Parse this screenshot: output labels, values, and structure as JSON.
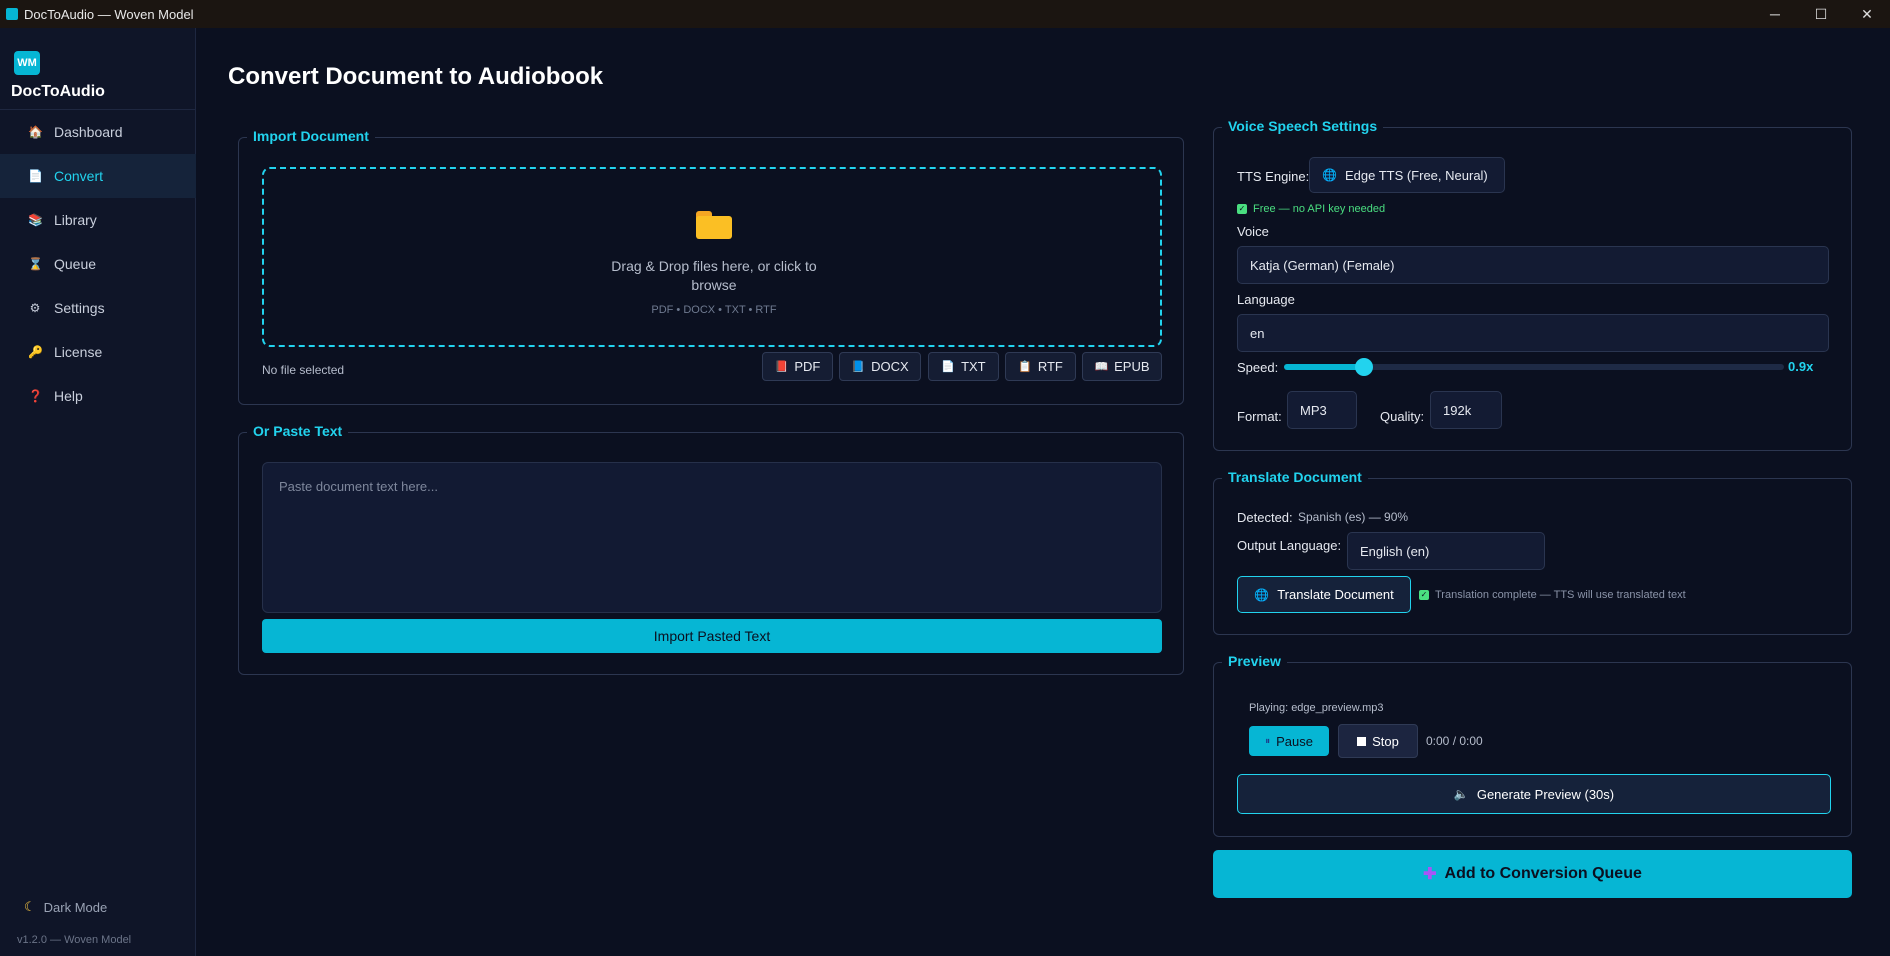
{
  "window": {
    "title": "DocToAudio — Woven Model",
    "controls": {
      "minimize": "─",
      "maximize": "☐",
      "close": "✕"
    }
  },
  "sidebar": {
    "logo_text": "WM",
    "brand": "DocToAudio",
    "items": [
      {
        "label": "Dashboard",
        "icon": "home-icon",
        "glyph": "🏠",
        "active": false
      },
      {
        "label": "Convert",
        "icon": "document-icon",
        "glyph": "📄",
        "active": true
      },
      {
        "label": "Library",
        "icon": "books-icon",
        "glyph": "📚",
        "active": false
      },
      {
        "label": "Queue",
        "icon": "hourglass-icon",
        "glyph": "⌛",
        "active": false
      },
      {
        "label": "Settings",
        "icon": "gear-icon",
        "glyph": "⚙",
        "active": false
      },
      {
        "label": "License",
        "icon": "key-icon",
        "glyph": "🔑",
        "active": false
      },
      {
        "label": "Help",
        "icon": "question-icon",
        "glyph": "❓",
        "active": false
      }
    ],
    "dark_mode_label": "Dark Mode",
    "version": "v1.2.0 — Woven Model"
  },
  "page": {
    "title": "Convert Document to Audiobook"
  },
  "import_document": {
    "title": "Import Document",
    "drop_text": "Drag & Drop files here, or click to browse",
    "formats_hint": "PDF • DOCX • TXT • RTF",
    "file_status": "No file selected",
    "buttons": [
      {
        "label": "PDF",
        "glyph": "📕"
      },
      {
        "label": "DOCX",
        "glyph": "📘"
      },
      {
        "label": "TXT",
        "glyph": "📄"
      },
      {
        "label": "RTF",
        "glyph": "📋"
      },
      {
        "label": "EPUB",
        "glyph": "📖"
      }
    ]
  },
  "paste_text": {
    "title": "Or Paste Text",
    "placeholder": "Paste document text here...",
    "import_button": "Import Pasted Text"
  },
  "voice_settings": {
    "title": "Voice  Speech Settings",
    "tts_engine_label": "TTS Engine:",
    "tts_engine_value": "Edge TTS (Free, Neural)",
    "tts_note": "Free — no API key needed",
    "voice_label": "Voice",
    "voice_value": "Katja (German) (Female)",
    "language_label": "Language",
    "language_value": "en",
    "speed_label": "Speed:",
    "speed_value": "0.9x",
    "speed_fraction": 0.16,
    "format_label": "Format:",
    "format_value": "MP3",
    "quality_label": "Quality:",
    "quality_value": "192k"
  },
  "translate": {
    "title": "Translate Document",
    "detected_label": "Detected:",
    "detected_value": "Spanish (es) — 90%",
    "output_label": "Output Language:",
    "output_value": "English (en)",
    "button": "Translate Document",
    "status": "Translation complete — TTS will use translated text"
  },
  "preview": {
    "title": "Preview",
    "playing": "Playing: edge_preview.mp3",
    "pause": "Pause",
    "stop": "Stop",
    "time": "0:00 / 0:00",
    "generate": "Generate Preview (30s)"
  },
  "queue_button": "Add to Conversion Queue",
  "colors": {
    "accent": "#06b6d4",
    "accent_light": "#22d3ee",
    "background": "#0b1020",
    "success": "#4ade80"
  }
}
